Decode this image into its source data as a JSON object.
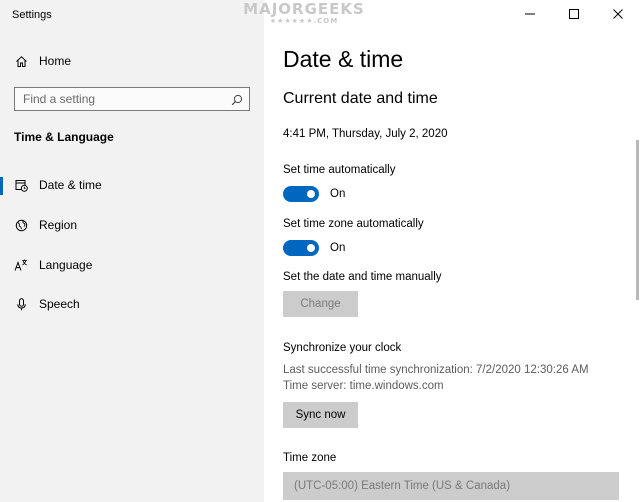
{
  "window": {
    "title": "Settings",
    "watermark": "MAJORGEEKS",
    "watermark_stars": "★★★★★★.COM"
  },
  "sidebar": {
    "home_label": "Home",
    "search": {
      "placeholder": "Find a setting"
    },
    "section_title": "Time & Language",
    "items": [
      {
        "label": "Date & time",
        "icon": "calendar-clock-icon",
        "selected": true
      },
      {
        "label": "Region",
        "icon": "globe-icon",
        "selected": false
      },
      {
        "label": "Language",
        "icon": "language-icon",
        "selected": false
      },
      {
        "label": "Speech",
        "icon": "microphone-icon",
        "selected": false
      }
    ]
  },
  "main": {
    "title": "Date & time",
    "current_heading": "Current date and time",
    "current_value": "4:41 PM, Thursday, July 2, 2020",
    "set_time_auto": {
      "label": "Set time automatically",
      "state": "On"
    },
    "set_timezone_auto": {
      "label": "Set time zone automatically",
      "state": "On"
    },
    "manual": {
      "label": "Set the date and time manually",
      "button": "Change"
    },
    "sync": {
      "heading": "Synchronize your clock",
      "last_sync": "Last successful time synchronization: 7/2/2020 12:30:26 AM",
      "server": "Time server: time.windows.com",
      "button": "Sync now"
    },
    "timezone": {
      "label": "Time zone",
      "value": "(UTC-05:00) Eastern Time (US & Canada)"
    }
  },
  "colors": {
    "accent": "#0067c0",
    "sidebar_bg": "#f2f2f2",
    "button_bg": "#cccccc"
  }
}
